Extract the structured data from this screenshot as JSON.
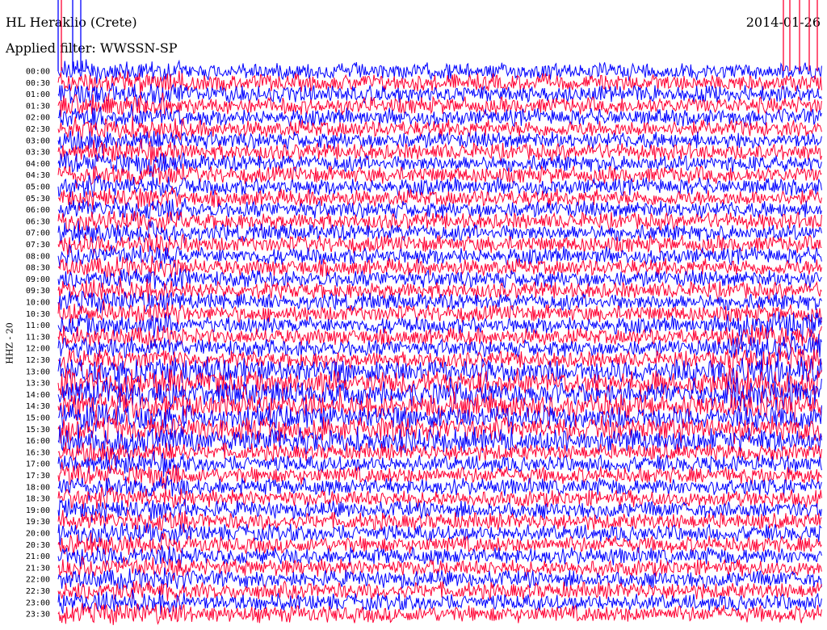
{
  "header": {
    "station": "HL Heraklio (Crete)",
    "date": "2014-01-26",
    "filter": "Applied filter: WWSSN-SP",
    "channel": "HHZ - 20"
  },
  "colors": {
    "trace_a": "#0000ff",
    "trace_b": "#ff0033"
  },
  "chart_data": {
    "type": "line",
    "title": "HL Heraklio (Crete)",
    "ylabel": "HHZ - 20",
    "grid": false,
    "ytick_labels": [
      "00:00",
      "00:30",
      "01:00",
      "01:30",
      "02:00",
      "02:30",
      "03:00",
      "03:30",
      "04:00",
      "04:30",
      "05:00",
      "05:30",
      "06:00",
      "06:30",
      "07:00",
      "07:30",
      "08:00",
      "08:30",
      "09:00",
      "09:30",
      "10:00",
      "10:30",
      "11:00",
      "11:30",
      "12:00",
      "12:30",
      "13:00",
      "13:30",
      "14:00",
      "14:30",
      "15:00",
      "15:30",
      "16:00",
      "16:30",
      "17:00",
      "17:30",
      "18:00",
      "18:30",
      "19:00",
      "19:30",
      "20:00",
      "20:30",
      "21:00",
      "21:30",
      "22:00",
      "22:30",
      "23:00",
      "23:30"
    ],
    "series_colors": [
      "#0000ff",
      "#ff0033"
    ]
  }
}
